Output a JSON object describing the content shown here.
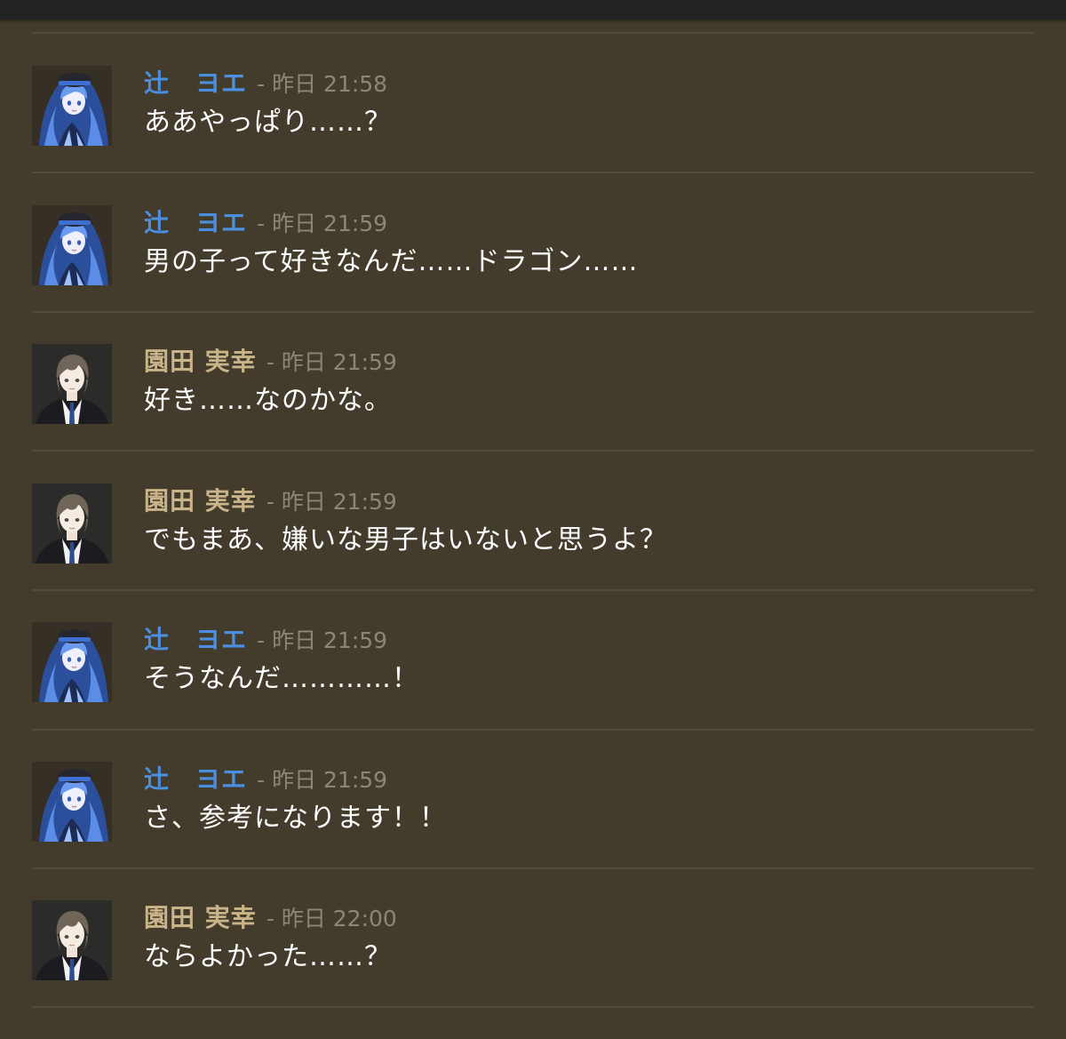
{
  "messages": [
    {
      "author": "辻　ヨエ",
      "sep": "-",
      "time": "昨日 21:58",
      "text": "ああやっぱり……？",
      "avatar": "yoe-avatar"
    },
    {
      "author": "辻　ヨエ",
      "sep": "-",
      "time": "昨日 21:59",
      "text": "男の子って好きなんだ……ドラゴン……",
      "avatar": "yoe-avatar"
    },
    {
      "author": "園田 実幸",
      "sep": "-",
      "time": "昨日 21:59",
      "text": "好き……なのかな。",
      "avatar": "mika-avatar"
    },
    {
      "author": "園田 実幸",
      "sep": "-",
      "time": "昨日 21:59",
      "text": "でもまあ、嫌いな男子はいないと思うよ？",
      "avatar": "mika-avatar"
    },
    {
      "author": "辻　ヨエ",
      "sep": "-",
      "time": "昨日 21:59",
      "text": "そうなんだ…………！",
      "avatar": "yoe-avatar"
    },
    {
      "author": "辻　ヨエ",
      "sep": "-",
      "time": "昨日 21:59",
      "text": "さ、参考になります！！",
      "avatar": "yoe-avatar"
    },
    {
      "author": "園田 実幸",
      "sep": "-",
      "time": "昨日 22:00",
      "text": "ならよかった……？",
      "avatar": "mika-avatar"
    }
  ],
  "colors": {
    "background": "#433b2b",
    "divider": "#54493a",
    "author_yoe": "#4b8fe0",
    "author_mika": "#c9b48a",
    "timestamp": "#8d8677",
    "text": "#ffffff"
  }
}
